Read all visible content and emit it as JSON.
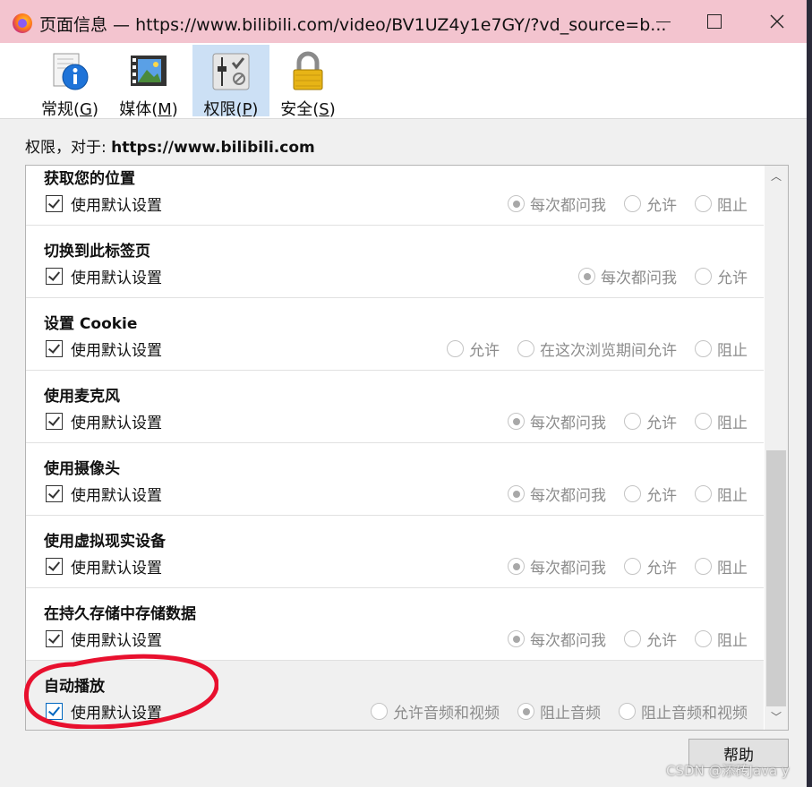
{
  "window": {
    "title": "页面信息 — https://www.bilibili.com/video/BV1UZ4y1e7GY/?vd_source=b..."
  },
  "tabs": [
    {
      "label": "常规(",
      "key": "G",
      "tail": ")",
      "icon": "info-icon"
    },
    {
      "label": "媒体(",
      "key": "M",
      "tail": ")",
      "icon": "media-icon"
    },
    {
      "label": "权限(",
      "key": "P",
      "tail": ")",
      "icon": "permissions-icon",
      "active": true
    },
    {
      "label": "安全(",
      "key": "S",
      "tail": ")",
      "icon": "lock-icon"
    }
  ],
  "permissions": {
    "header_prefix": "权限，对于: ",
    "site": "https://www.bilibili.com",
    "default_label": "使用默认设置",
    "rows": [
      {
        "name": "获取您的位置",
        "options": [
          "每次都问我",
          "允许",
          "阻止"
        ],
        "selected": 0
      },
      {
        "name": "切换到此标签页",
        "options": [
          "每次都问我",
          "允许"
        ],
        "selected": 0
      },
      {
        "name": "设置 Cookie",
        "options": [
          "允许",
          "在这次浏览期间允许",
          "阻止"
        ],
        "selected": -1
      },
      {
        "name": "使用麦克风",
        "options": [
          "每次都问我",
          "允许",
          "阻止"
        ],
        "selected": 0
      },
      {
        "name": "使用摄像头",
        "options": [
          "每次都问我",
          "允许",
          "阻止"
        ],
        "selected": 0
      },
      {
        "name": "使用虚拟现实设备",
        "options": [
          "每次都问我",
          "允许",
          "阻止"
        ],
        "selected": 0
      },
      {
        "name": "在持久存储中存储数据",
        "options": [
          "每次都问我",
          "允许",
          "阻止"
        ],
        "selected": 0
      },
      {
        "name": "自动播放",
        "options": [
          "允许音频和视频",
          "阻止音频",
          "阻止音频和视频"
        ],
        "selected": 1
      }
    ]
  },
  "buttons": {
    "help": "帮助"
  },
  "watermark": "CSDN @添砖Java y",
  "colors": {
    "titlebar": "#f3c4cf",
    "active_tab": "#cce0f5",
    "annotation": "#e8102e"
  }
}
